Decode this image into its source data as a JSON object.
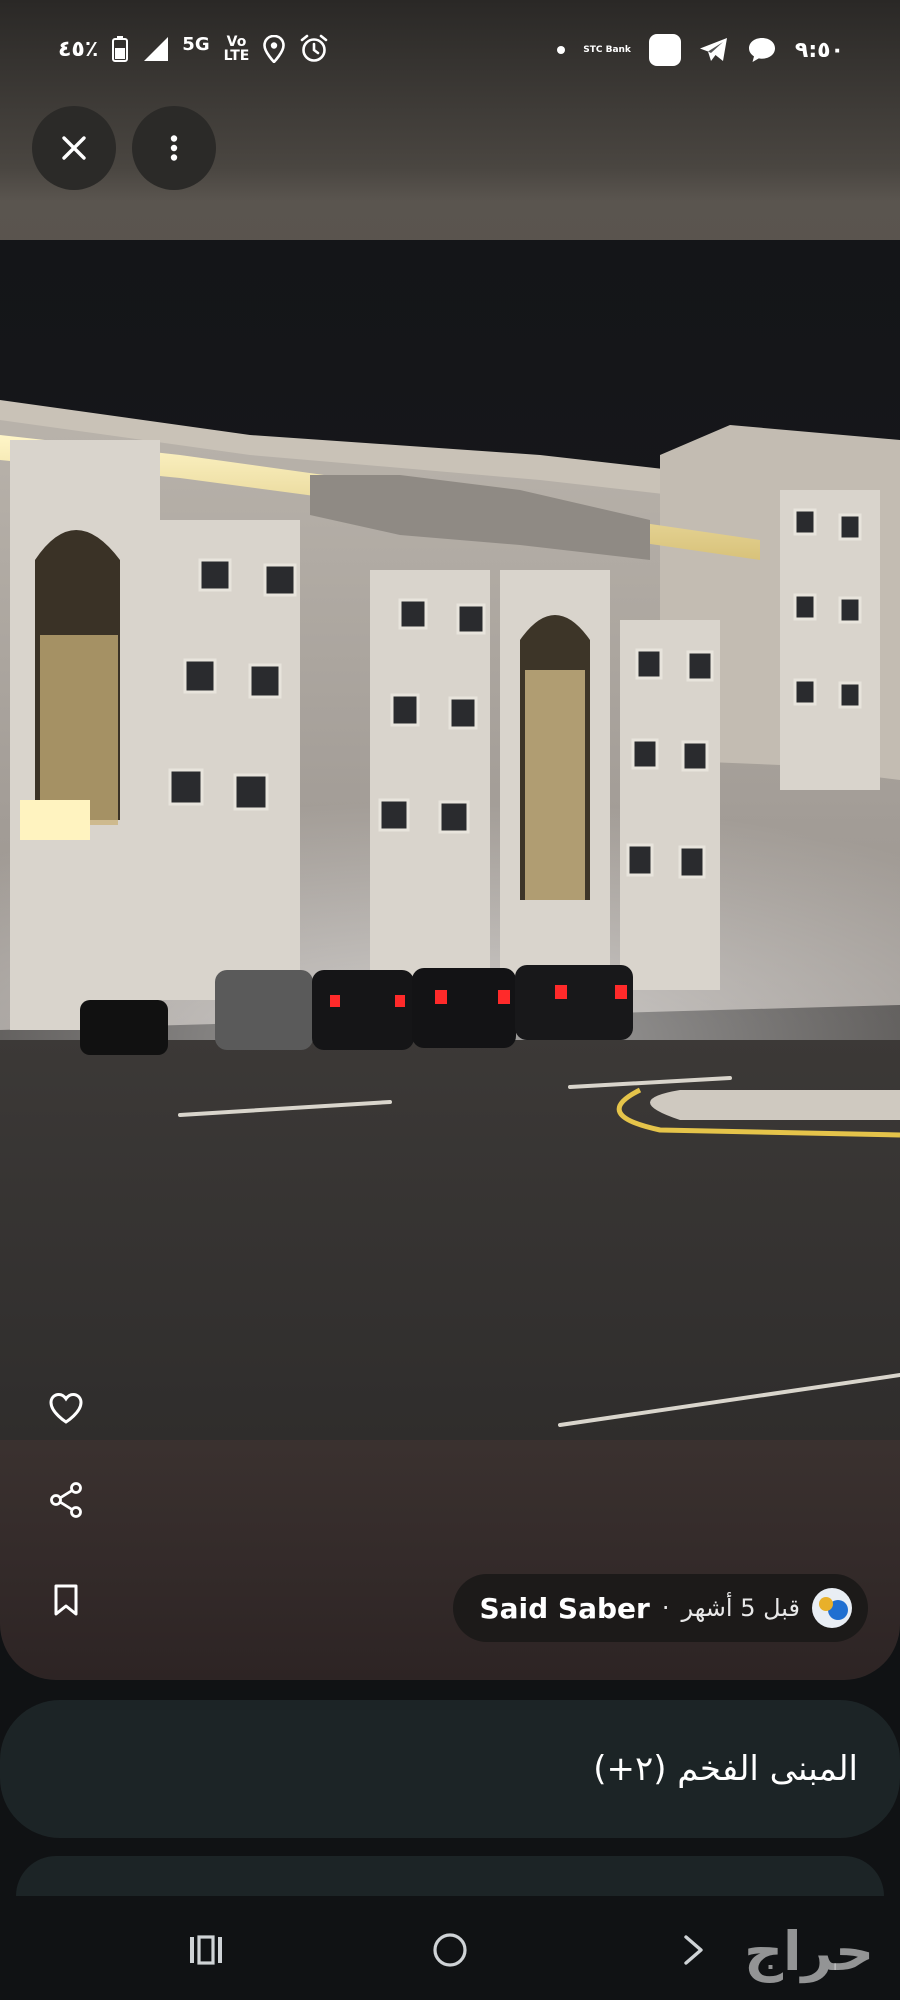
{
  "status_bar": {
    "battery_text": "٤٥٪",
    "network_label": "5G",
    "volte_top": "Vo",
    "volte_bottom": "LTE",
    "time": "٩:٥٠",
    "carrier_label": "STC Bank"
  },
  "actions": {
    "close_icon": "close-icon",
    "menu_icon": "more-vert-icon",
    "like_icon": "heart-icon",
    "share_icon": "share-icon",
    "save_icon": "bookmark-icon"
  },
  "author": {
    "name": "Said Saber",
    "separator": "·",
    "time_ago": "قبل 5 أشهر"
  },
  "post": {
    "title": "المبنى الفخم (٢+)"
  },
  "watermark": "حراج",
  "colors": {
    "background": "#101214",
    "card": "#1c2426",
    "chip": "#1c1a19"
  }
}
